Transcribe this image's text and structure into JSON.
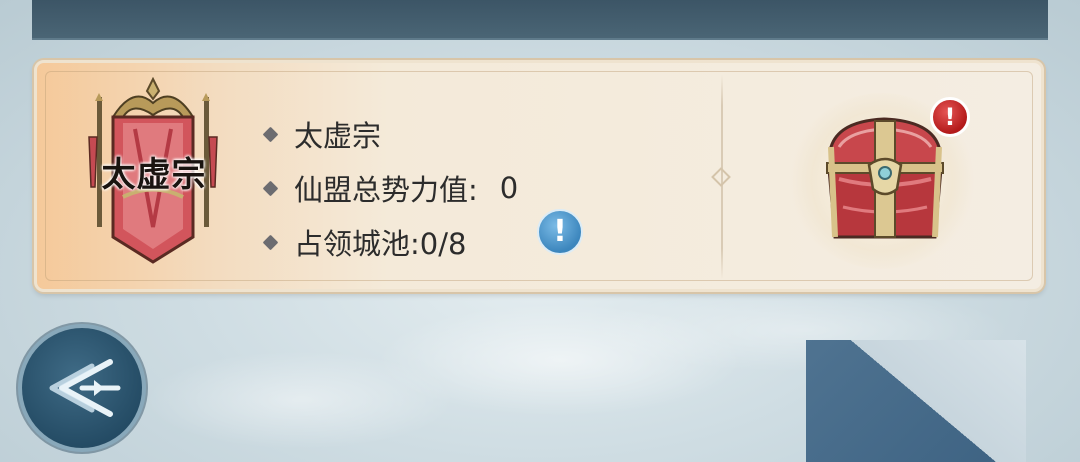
{
  "alliance": {
    "banner_name": "太虚宗",
    "name": "太虚宗",
    "power_label": "仙盟总势力值:",
    "power_value": "0",
    "cities_text": "占领城池:0/8"
  },
  "badges": {
    "info_glyph": "!",
    "alert_glyph": "!"
  },
  "icons": {
    "banner": "sect-banner-icon",
    "chest": "treasure-chest-icon",
    "info": "info-icon",
    "alert": "alert-badge-icon",
    "back": "back-arrow-icon"
  },
  "colors": {
    "panel_accent": "#f5c99a",
    "info_blue": "#3c86bd",
    "alert_red": "#c62222",
    "banner_red": "#d2555c"
  }
}
